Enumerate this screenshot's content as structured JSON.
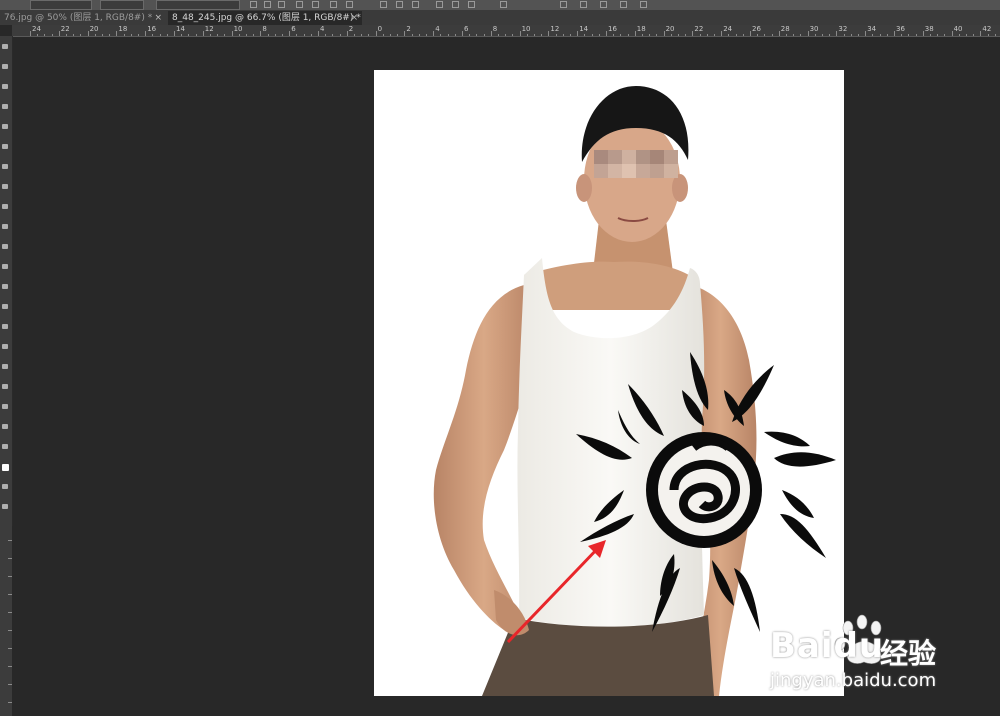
{
  "tabs": [
    {
      "label": "76.jpg @ 50% (图层 1, RGB/8#) *",
      "close": "×",
      "active": false
    },
    {
      "label": "8_48_245.jpg @ 66.7% (图层 1, RGB/8#) *",
      "close": "×",
      "active": true
    }
  ],
  "ruler": {
    "horizontal_labels": [
      "24",
      "22",
      "20",
      "18",
      "16",
      "14",
      "12",
      "10",
      "8",
      "6",
      "4",
      "2",
      "0",
      "2",
      "4",
      "6",
      "8",
      "10",
      "12",
      "14",
      "16",
      "18",
      "20",
      "22",
      "24",
      "26",
      "28",
      "30",
      "32",
      "34",
      "36",
      "38",
      "40",
      "42"
    ]
  },
  "watermark": {
    "brand": "Baidu",
    "product": "经验",
    "url": "jingyan.baidu.com"
  },
  "colors": {
    "workspace": "#282828",
    "panel": "#3c3c3c",
    "annotation_arrow": "#e8262a",
    "tattoo": "#0b0b0b"
  }
}
